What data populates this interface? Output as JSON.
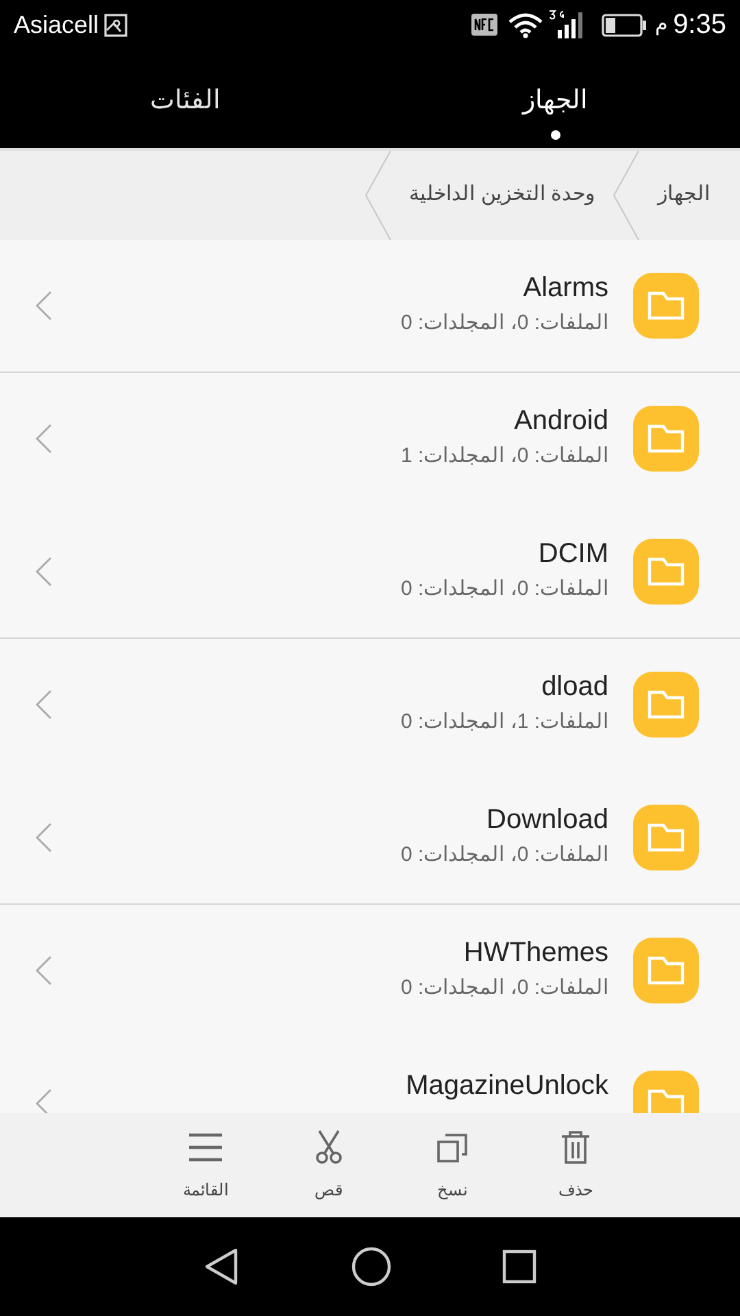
{
  "status_bar": {
    "carrier": "Asiacell",
    "am_pm": "م",
    "time": "9:35"
  },
  "tabs": [
    {
      "label": "الجهاز",
      "selected": true
    },
    {
      "label": "الفئات",
      "selected": false
    }
  ],
  "breadcrumb": [
    "الجهاز",
    "وحدة التخزين الداخلية"
  ],
  "folders": [
    {
      "name": "Alarms",
      "details": "الملفات: 0، المجلدات: 0",
      "separator": true
    },
    {
      "name": "Android",
      "details": "الملفات: 0، المجلدات: 1",
      "separator": false
    },
    {
      "name": "DCIM",
      "details": "الملفات: 0، المجلدات: 0",
      "separator": true
    },
    {
      "name": "dload",
      "details": "الملفات: 1، المجلدات: 0",
      "separator": false
    },
    {
      "name": "Download",
      "details": "الملفات: 0، المجلدات: 0",
      "separator": true
    },
    {
      "name": "HWThemes",
      "details": "الملفات: 0، المجلدات: 0",
      "separator": false
    },
    {
      "name": "MagazineUnlock"
    }
  ],
  "toolbar": [
    {
      "kind": "delete",
      "label": "حذف"
    },
    {
      "kind": "copy",
      "label": "نسخ"
    },
    {
      "kind": "cut",
      "label": "قص"
    },
    {
      "kind": "menu",
      "label": "القائمة"
    }
  ]
}
